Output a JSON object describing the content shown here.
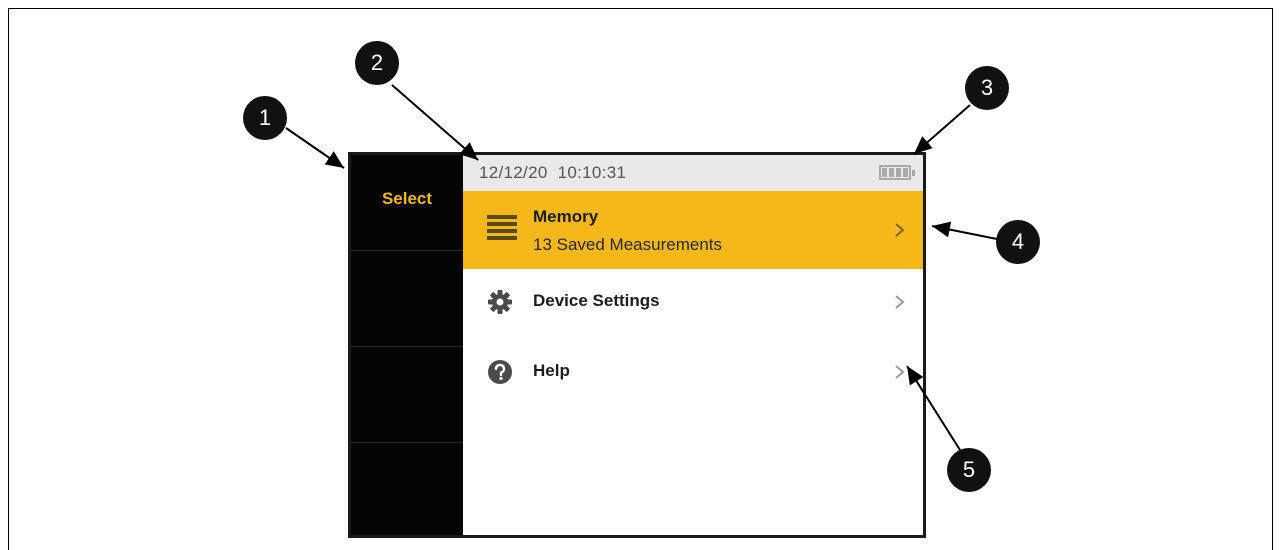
{
  "softkeys": [
    {
      "label": "Select"
    },
    {
      "label": ""
    },
    {
      "label": ""
    },
    {
      "label": ""
    }
  ],
  "status": {
    "date": "12/12/20",
    "time": "10:10:31",
    "battery_icon": "battery-full-icon"
  },
  "menu": [
    {
      "title": "Memory",
      "subtitle": "13 Saved Measurements",
      "icon": "memory-list-icon",
      "selected": true
    },
    {
      "title": "Device Settings",
      "subtitle": "",
      "icon": "gear-icon",
      "selected": false
    },
    {
      "title": "Help",
      "subtitle": "",
      "icon": "help-icon",
      "selected": false
    }
  ],
  "callouts": [
    "1",
    "2",
    "3",
    "4",
    "5"
  ],
  "colors": {
    "accent": "#f6b818",
    "softkey_bg": "#050505",
    "softkey_text": "#f5b817",
    "statusbar_bg": "#e9e9e9"
  }
}
